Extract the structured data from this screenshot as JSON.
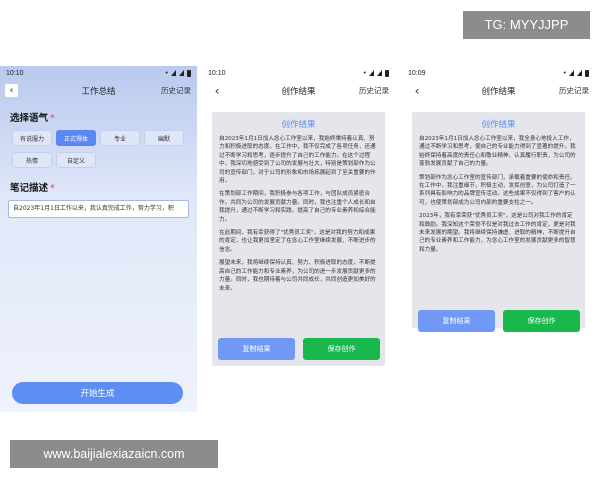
{
  "watermarks": {
    "tg": "TG: MYYJJPP",
    "url": "www.baijialexiazaicn.com"
  },
  "screen1": {
    "time": "10:10",
    "title": "工作总结",
    "history": "历史记录",
    "tone_label": "选择语气",
    "tones": [
      {
        "label": "有说服力",
        "active": false
      },
      {
        "label": "正式得体",
        "active": true
      },
      {
        "label": "专业",
        "active": false
      },
      {
        "label": "幽默",
        "active": false
      },
      {
        "label": "热情",
        "active": false
      },
      {
        "label": "自定义",
        "active": false
      }
    ],
    "notes_label": "笔记描述",
    "notes_value": "自2023年1月1日工作以来，我认真完成工作，努力学习，积",
    "start_label": "开始生成"
  },
  "screen2": {
    "time": "10:10",
    "title": "创作结果",
    "history": "历史记录",
    "result_title": "创作结果",
    "paragraphs": [
      "自2023年1月1日加入念心工作室以来，我始终秉持着认真、努力和积极进取的态度。在工作中，我不仅完成了各项任务，还通过不断学习和思考，逐步提升了自己的工作能力。在这个过程中，我深切地感受到了公司的发展与壮大，特别是策划部作为公司的宣传部门，对于公司的形象和市场拓展起到了至关重要的作用。",
      "在策划部工作期间，我积极参与各项工作，与团队成员紧密合作，共同为公司的发展贡献力量。同时，我也注重个人成长和自我提升，通过不断学习和实践，提高了自己的专业素养和综合能力。",
      "在此期间，我有幸获得了\"优秀员工奖\"，这是对我的努力和成果的肯定，也让我更加坚定了在念心工作室继续发展、不断进步的信念。",
      "展望未来，我将继续保持认真、努力、积极进取的态度，不断提高自己的工作能力和专业素养，为公司的进一步发展贡献更多的力量。同时，我也期待着与公司共同成长，共同创造更加美好的未来。"
    ],
    "copy_label": "复制结果",
    "save_label": "保存创作"
  },
  "screen3": {
    "time": "10:09",
    "title": "创作结果",
    "history": "历史记录",
    "result_title": "创作结果",
    "paragraphs": [
      "自2023年1月1日加入念心工作室以来，我全身心地投入工作，通过不断学习和思考，使自己的专业能力得到了显著的提升。我始终保持着高度的责任心和敬业精神，认真履行职责，为公司的蓬勃发展贡献了自己的力量。",
      "策划部作为念心工作室的宣传部门，承载着重要的使命和责任。在工作中，我注重细节，积极主动，发挥创意，为公司打造了一系列具有影响力的品牌宣传活动。这些成果不仅得到了客户的认可，也使策划部成为公司内部的重要支柱之一。",
      "2023年，我有幸荣获\"优秀员工奖\"，这是公司对我工作的肯定和鼓励。我深知这个荣誉不仅是对我过去工作的肯定，更是对我未来发展的期望。我将继续保持谦虚、进取的精神，不断提升自己的专业素养和工作能力，为念心工作室的发展贡献更多的智慧和力量。"
    ],
    "copy_label": "复制结果",
    "save_label": "保存创作"
  }
}
